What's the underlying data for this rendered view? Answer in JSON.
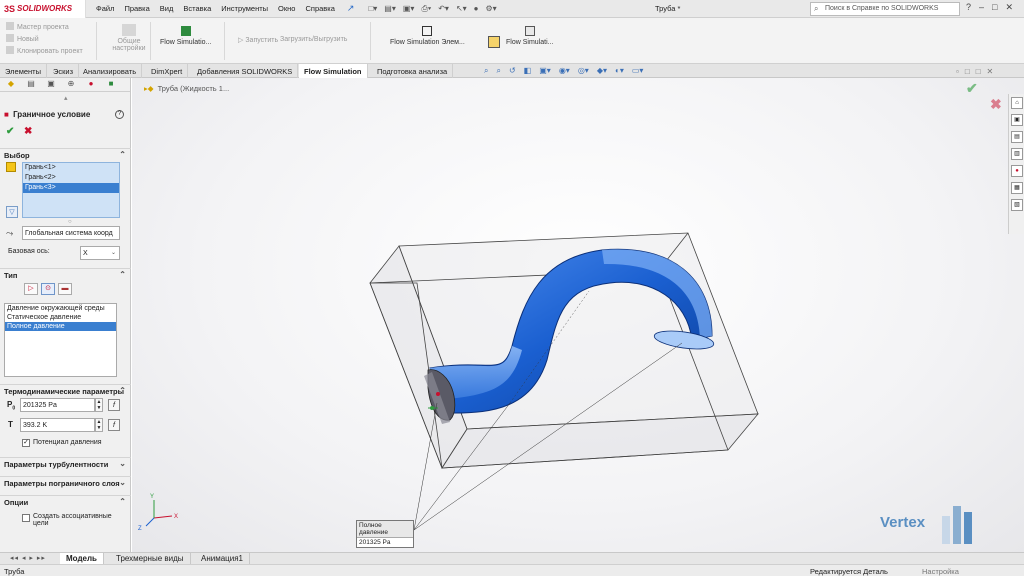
{
  "app": {
    "logo_ds": "3S",
    "logo_text": "SOLIDWORKS",
    "doc_title": "Труба *",
    "help_search_placeholder": "Поиск в Справке по SOLIDWORKS"
  },
  "menu": [
    "Файл",
    "Правка",
    "Вид",
    "Вставка",
    "Инструменты",
    "Окно",
    "Справка"
  ],
  "command_manager": {
    "project_master": "Мастер проекта",
    "new": "Новый",
    "clone_project": "Клонировать проект",
    "general_settings_1": "Общие",
    "general_settings_2": "настройки",
    "flow_simulation_1": "Flow Simulatio...",
    "run": "Запустить",
    "load_unload": "Загрузить/Выгрузить",
    "flow_simulation_elements": "Flow Simulation Элем...",
    "flow_simulation_2": "Flow Simulati..."
  },
  "tabs": [
    "Элементы",
    "Эскиз",
    "Анализировать",
    "DimXpert",
    "Добавления SOLIDWORKS",
    "Flow Simulation",
    "Подготовка анализа"
  ],
  "active_tab": "Flow Simulation",
  "panel": {
    "title": "Граничное условие",
    "help": "?",
    "ok": "✔",
    "cancel": "✖",
    "selection": {
      "header": "Выбор",
      "faces": [
        "Грань<1>",
        "Грань<2>",
        "Грань<3>"
      ],
      "selected_face": "Грань<3>",
      "coord_system": "Глобальная система коорд",
      "base_axis_label": "Базовая ось:",
      "base_axis_value": "X"
    },
    "type": {
      "header": "Тип",
      "options": [
        "Давление окружающей среды",
        "Статическое давление",
        "Полное давление"
      ],
      "selected": "Полное давление"
    },
    "thermo": {
      "header": "Термодинамические параметры",
      "p_symbol": "P",
      "p_sub": "0",
      "p_value": "201325 Pa",
      "t_symbol": "T",
      "t_value": "393.2 K",
      "potential_label": "Потенциал давления",
      "potential_checked": true
    },
    "turbulence_header": "Параметры турбулентности",
    "boundary_layer_header": "Параметры пограничного слоя",
    "options": {
      "header": "Опции",
      "assoc_label_1": "Создать ассоциативные",
      "assoc_label_2": "цели",
      "assoc_checked": false
    }
  },
  "viewport": {
    "tree_label": "Труба (Жидкость 1...",
    "tooltip_header": "Полное давление",
    "tooltip_value": "201325 Pa",
    "watermark": "Vertex",
    "colors": {
      "pipe": "#1a5fd0",
      "pipe_inner": "#6fa8f5",
      "box_edge": "#444444"
    }
  },
  "bottom_tabs": [
    "Модель",
    "Трехмерные виды",
    "Анимация1"
  ],
  "active_bottom_tab": "Модель",
  "status": {
    "left": "Труба",
    "middle": "Редактируется Деталь",
    "right": "Настройка"
  }
}
